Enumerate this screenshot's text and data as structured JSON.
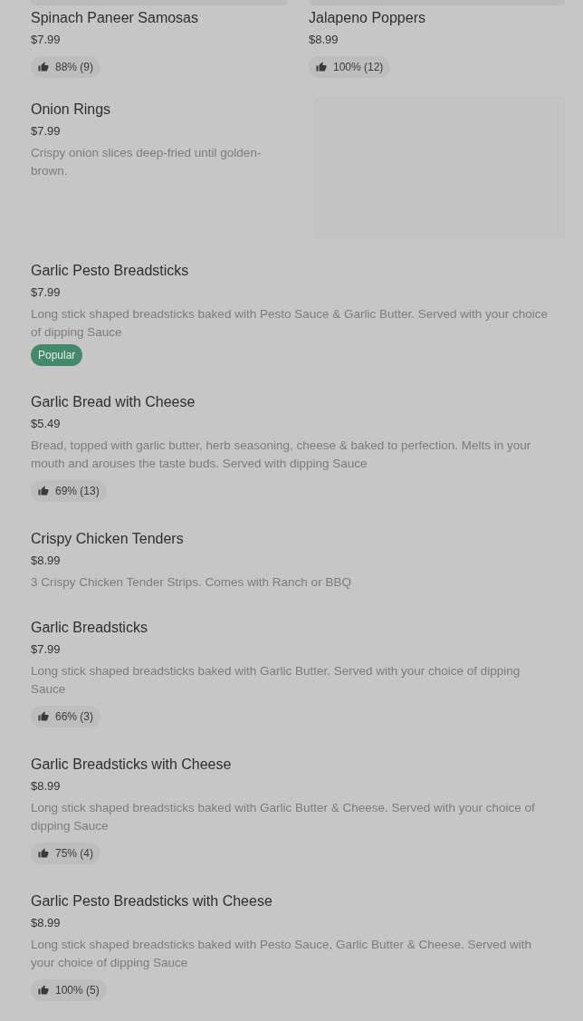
{
  "top_cards": [
    {
      "name": "Spinach Paneer Samosas",
      "price": "$7.99",
      "rating": "88% (9)"
    },
    {
      "name": "Jalapeno Poppers",
      "price": "$8.99",
      "rating": "100% (12)"
    }
  ],
  "featured": {
    "name": "Onion Rings",
    "price": "$7.99",
    "description": "Crispy onion slices deep-fried until golden-brown."
  },
  "items": [
    {
      "name": "Garlic Pesto Breadsticks",
      "price": "$7.99",
      "description": "Long stick shaped breadsticks baked with Pesto Sauce & Garlic Butter. Served with your choice of dipping Sauce",
      "badge": "Popular"
    },
    {
      "name": "Garlic Bread with Cheese",
      "price": "$5.49",
      "description": "Bread, topped with garlic butter, herb seasoning, cheese & baked to perfection. Melts in your mouth and arouses the taste buds. Served with dipping Sauce",
      "rating": "69% (13)"
    },
    {
      "name": "Crispy Chicken Tenders",
      "price": "$8.99",
      "description": "3 Crispy Chicken Tender Strips. Comes with Ranch or BBQ"
    },
    {
      "name": "Garlic Breadsticks",
      "price": "$7.99",
      "description": "Long stick shaped breadsticks baked with Garlic Butter. Served with your choice of dipping Sauce",
      "rating": "66% (3)"
    },
    {
      "name": "Garlic Breadsticks with Cheese",
      "price": "$8.99",
      "description": "Long stick shaped breadsticks baked with Garlic Butter & Cheese. Served with your choice of dipping Sauce",
      "rating": "75% (4)"
    },
    {
      "name": "Garlic Pesto Breadsticks with Cheese",
      "price": "$8.99",
      "description": "Long stick shaped breadsticks baked with Pesto Sauce, Garlic Butter & Cheese. Served with your choice of dipping Sauce",
      "rating": "100% (5)"
    }
  ]
}
